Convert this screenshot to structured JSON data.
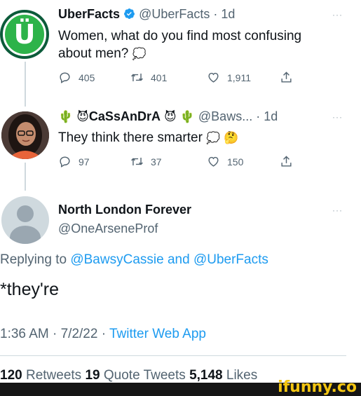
{
  "tweet1": {
    "name": "UberFacts",
    "handle": "@UberFacts",
    "separator": " · ",
    "time": "1d",
    "text_line1": "Women, what do you find most confusing",
    "text_line2": "about men?",
    "replies": "405",
    "retweets": "401",
    "likes": "1,911"
  },
  "tweet2": {
    "name": "CaSsAnDrA",
    "handle": "@Baws...",
    "separator": " · ",
    "time": "1d",
    "text": "They think there smarter",
    "replies": "97",
    "retweets": "37",
    "likes": "150"
  },
  "tweet3": {
    "name": "North London Forever",
    "handle": "@OneArseneProf",
    "replying_prefix": "Replying to ",
    "replying_user1": "@BawsyCassie",
    "replying_and": " and ",
    "replying_user2": "@UberFacts",
    "text": "*they're",
    "time": "1:36 AM · 7/2/22 · ",
    "source": "Twitter Web App"
  },
  "stats": {
    "retweets_count": "120",
    "retweets_label": " Retweets  ",
    "quotes_count": "19",
    "quotes_label": " Quote Tweets  ",
    "likes_count": "5,148",
    "likes_label": " Likes"
  },
  "more_label": "···",
  "watermark": "ifunny.co",
  "avatar_letter": "Ü",
  "icons": [
    "verified-badge-icon",
    "reply-icon",
    "retweet-icon",
    "like-icon",
    "share-icon",
    "thought-balloon-icon",
    "thinking-face-icon",
    "cactus-icon",
    "devil-face-icon",
    "more-icon"
  ],
  "colors": {
    "accent": "#1d9bf0",
    "muted": "#536471",
    "brand": "#f3c511"
  }
}
